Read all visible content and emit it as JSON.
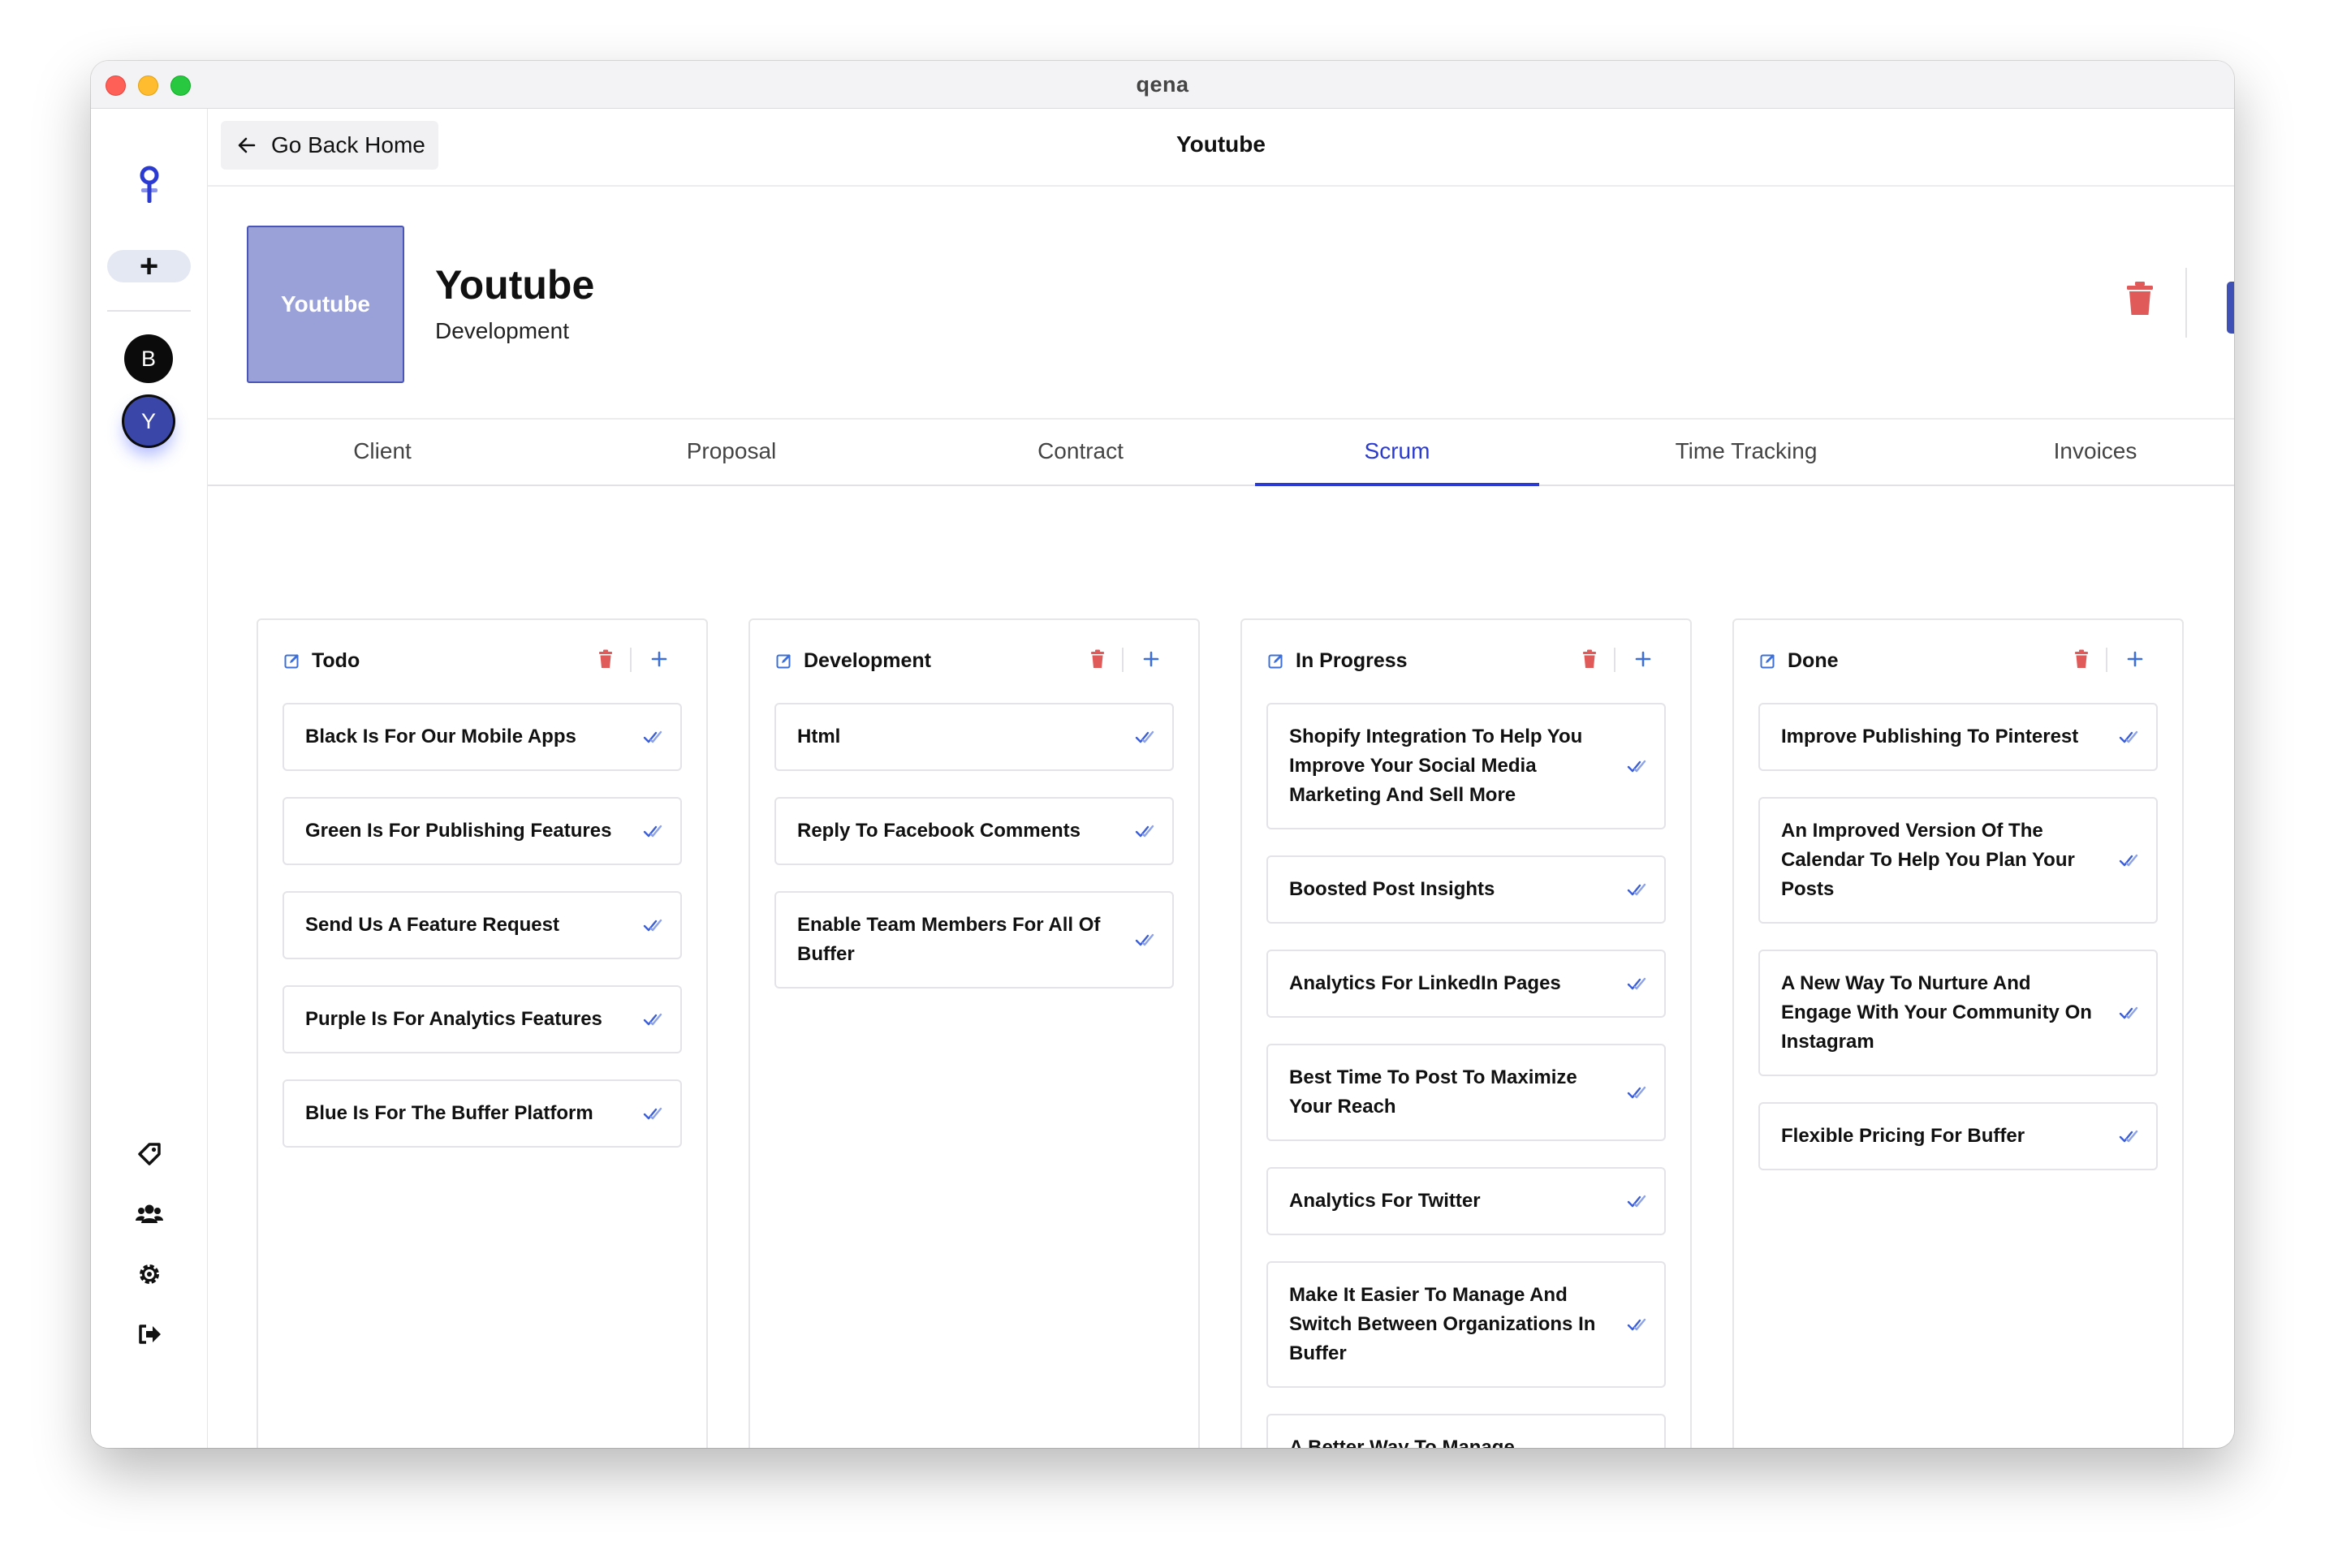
{
  "window": {
    "title": "qena"
  },
  "sidebar": {
    "add_label": "+",
    "avatars": [
      {
        "letter": "B"
      },
      {
        "letter": "Y"
      }
    ],
    "icons": [
      "tag-icon",
      "users-icon",
      "gear-icon",
      "logout-icon"
    ]
  },
  "topbar": {
    "back_label": "Go Back Home",
    "title": "Youtube"
  },
  "project": {
    "thumbnail_text": "Youtube",
    "name": "Youtube",
    "category": "Development",
    "accent_color": "#3f51b5",
    "thumb_color": "#9aa0d8"
  },
  "tabs": [
    {
      "label": "Client",
      "active": false
    },
    {
      "label": "Proposal",
      "active": false
    },
    {
      "label": "Contract",
      "active": false
    },
    {
      "label": "Scrum",
      "active": true
    },
    {
      "label": "Time Tracking",
      "active": false
    },
    {
      "label": "Invoices",
      "active": false
    }
  ],
  "board": {
    "columns": [
      {
        "title": "Todo",
        "cards": [
          "Black Is For Our Mobile Apps",
          "Green Is For Publishing Features",
          "Send Us A Feature Request",
          "Purple Is For Analytics Features",
          "Blue Is For The Buffer Platform"
        ]
      },
      {
        "title": "Development",
        "cards": [
          "Html",
          "Reply To Facebook Comments",
          "Enable Team Members For All Of Buffer"
        ]
      },
      {
        "title": "In Progress",
        "cards": [
          "Shopify Integration To Help You Improve Your Social Media Marketing And Sell More",
          "Boosted Post Insights",
          "Analytics For LinkedIn Pages",
          "Best Time To Post To Maximize Your Reach",
          "Analytics For Twitter",
          "Make It Easier To Manage And Switch Between Organizations In Buffer",
          "A Better Way To Manage \"Campaigns\" In Buffer"
        ]
      },
      {
        "title": "Done",
        "cards": [
          "Improve Publishing To Pinterest",
          "An Improved Version Of The Calendar To Help You Plan Your Posts",
          "A New Way To Nurture And Engage With Your Community On Instagram",
          "Flexible Pricing For Buffer"
        ]
      }
    ]
  }
}
